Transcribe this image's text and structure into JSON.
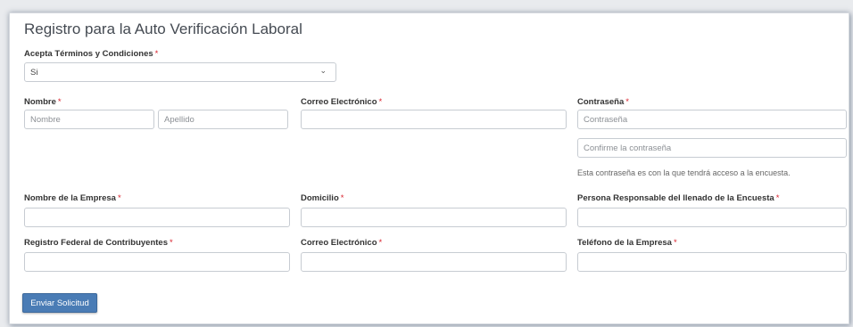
{
  "form": {
    "title": "Registro para la Auto Verificación Laboral",
    "required_mark": "*",
    "terms": {
      "label": "Acepta Términos y Condiciones",
      "value": "Si"
    },
    "nombre": {
      "label": "Nombre",
      "first_placeholder": "Nombre",
      "last_placeholder": "Apellido"
    },
    "email": {
      "label": "Correo Electrónico",
      "value": ""
    },
    "password": {
      "label": "Contraseña",
      "placeholder": "Contraseña",
      "confirm_placeholder": "Confirme la contraseña",
      "help": "Esta contraseña es con la que tendrá acceso a la encuesta."
    },
    "company_name": {
      "label": "Nombre de la Empresa",
      "value": ""
    },
    "address": {
      "label": "Domicilio",
      "value": ""
    },
    "responsible": {
      "label": "Persona Responsable del llenado de la Encuesta",
      "value": ""
    },
    "rfc": {
      "label": "Registro Federal de Contribuyentes",
      "value": ""
    },
    "company_email": {
      "label": "Correo Electrónico",
      "value": ""
    },
    "company_phone": {
      "label": "Teléfono de la Empresa",
      "value": ""
    },
    "submit_label": "Enviar Solicitud"
  }
}
